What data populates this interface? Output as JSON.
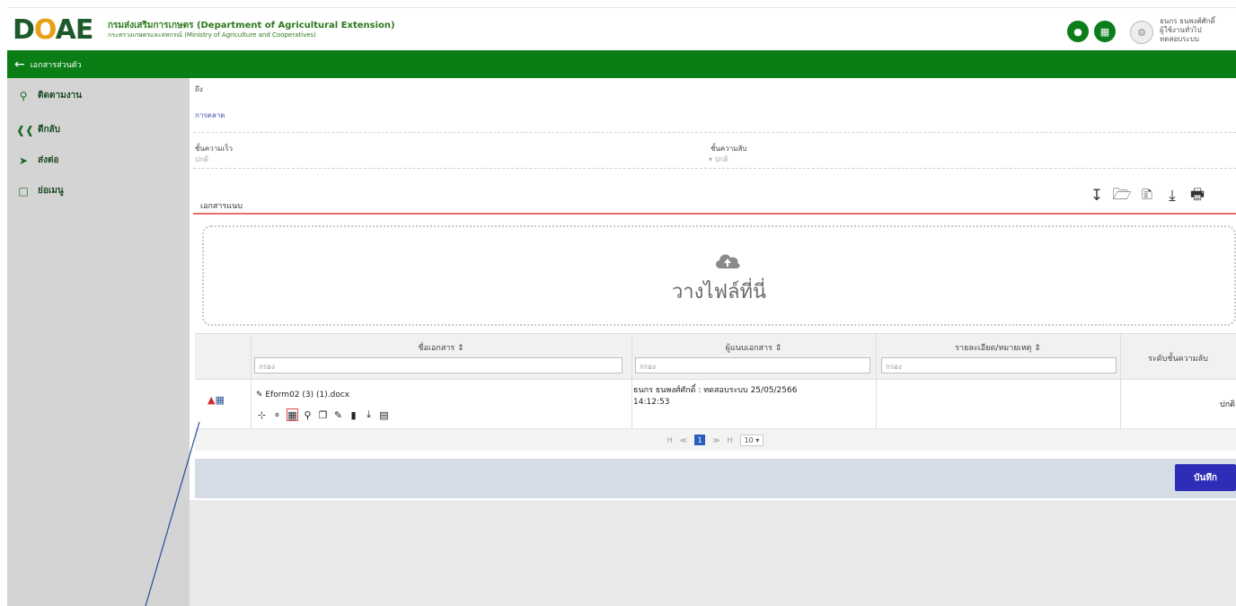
{
  "header": {
    "logo_text_left": "D",
    "logo_text_mid": "O",
    "logo_text_right": "AE",
    "dept_name": "กรมส่งเสริมการเกษตร (Department of Agricultural Extension)",
    "ministry_name": "กระทรวงเกษตรและสหกรณ์ (Ministry of Agriculture and Cooperatives)",
    "user_name": "ธนกร ธนพงศ์ศักดิ์",
    "user_role": "ผู้ใช้งานทั่วไป",
    "user_sub": "ทดสอบระบบ",
    "brand_color": "#0a7d14"
  },
  "greenbar": {
    "title": "เอกสารส่วนตัว"
  },
  "sidebar": {
    "items": [
      {
        "label": "ติดตามงาน",
        "icon": "search-icon"
      },
      {
        "label": "ตีกลับ",
        "icon": "reply-all-icon"
      },
      {
        "label": "ส่งต่อ",
        "icon": "send-icon"
      },
      {
        "label": "ย่อเมนู",
        "icon": "collapse-icon"
      }
    ]
  },
  "form": {
    "to_label": "ถึง",
    "to_value": "การตลาด",
    "speed_label": "ชั้นความเร็ว",
    "speed_value": "ปกติ",
    "secret_label": "ชั้นความลับ",
    "secret_value": "ปกติ"
  },
  "attachments": {
    "title": "เอกสารแนบ",
    "drop_text": "วางไฟล์ที่นี่",
    "columns": {
      "name": "ชื่อเอกสาร ⇕",
      "attacher": "ผู้แนบเอกสาร ⇕",
      "detail": "รายละเอียด/หมายเหตุ ⇕",
      "secret": "ระดับชั้นความลับ"
    },
    "filter_placeholder": "กรอง",
    "rows": [
      {
        "file_name": "Eform02 (3) (1).docx",
        "attacher_line1": "ธนกร ธนพงศ์ศักดิ์ : ทดสอบระบบ 25/05/2566",
        "attacher_line2": "14:12:53",
        "secret": "ปกติ"
      }
    ],
    "pager": {
      "first": "H",
      "prev": "≪",
      "current": "1",
      "next": "≫",
      "last": "H",
      "page_size": "10 ▾"
    }
  },
  "footer": {
    "save_label": "บันทึก"
  }
}
